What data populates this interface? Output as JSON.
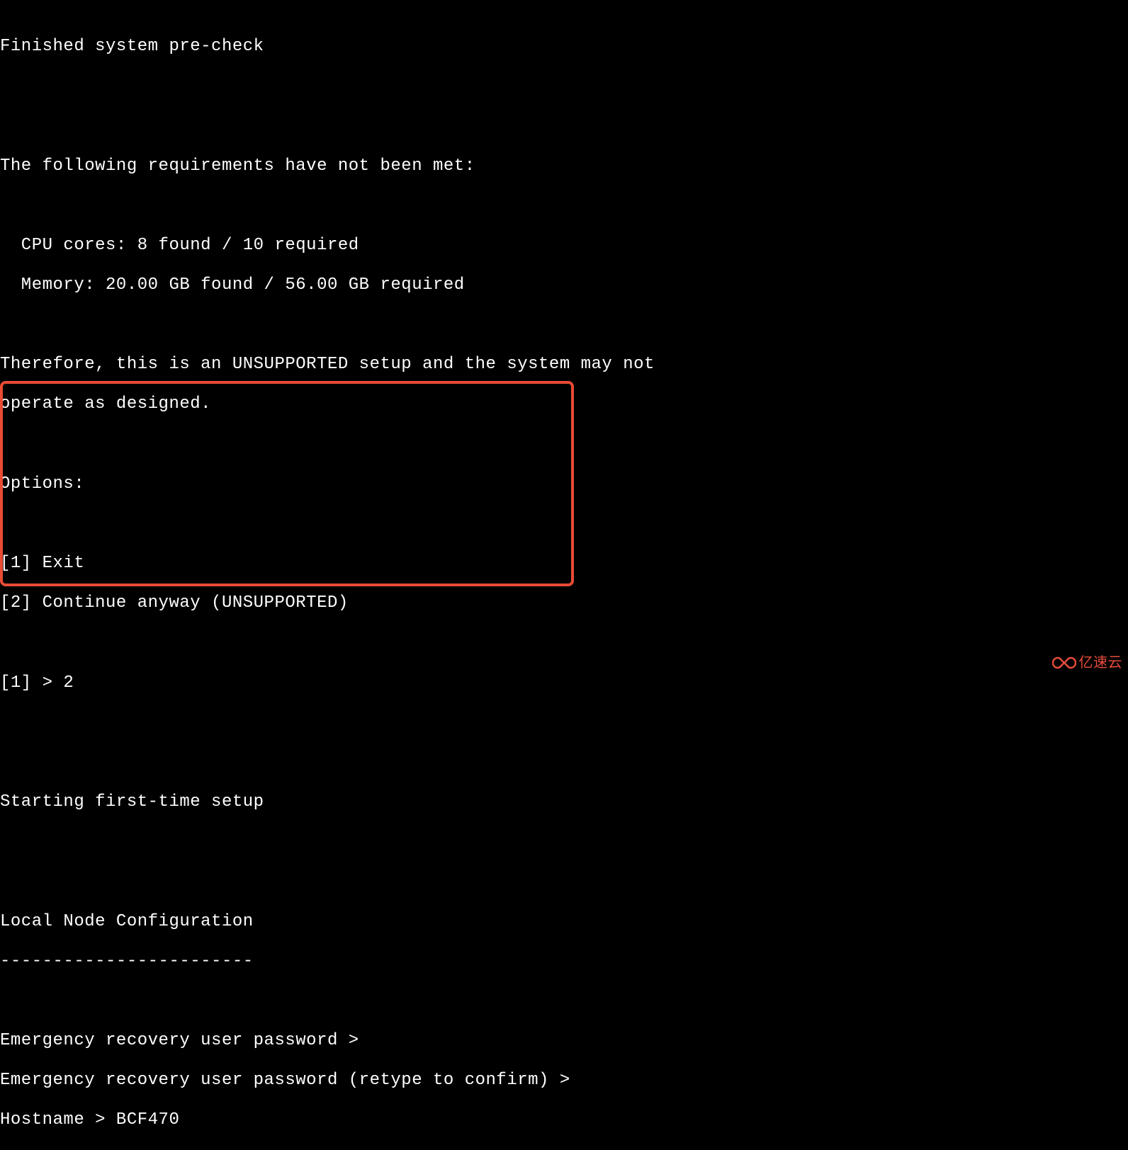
{
  "terminal": {
    "l1": "Finished system pre-check",
    "l2": "",
    "l3": "",
    "l4": "The following requirements have not been met:",
    "l5": "",
    "l6": "  CPU cores: 8 found / 10 required",
    "l7": "  Memory: 20.00 GB found / 56.00 GB required",
    "l8": "",
    "l9": "Therefore, this is an UNSUPPORTED setup and the system may not",
    "l10": "operate as designed.",
    "l11": "",
    "l12": "Options:",
    "l13": "",
    "l14": "[1] Exit",
    "l15": "[2] Continue anyway (UNSUPPORTED)",
    "l16": "",
    "l17": "[1] > 2",
    "l18": "",
    "l19": "",
    "l20": "Starting first-time setup",
    "l21": "",
    "l22": "",
    "l23": "Local Node Configuration",
    "l24": "------------------------",
    "l25": "",
    "l26": "Emergency recovery user password >",
    "l27": "Emergency recovery user password (retype to confirm) >",
    "l28": "Hostname > BCF470"
  },
  "watermark": {
    "text": "亿速云"
  }
}
